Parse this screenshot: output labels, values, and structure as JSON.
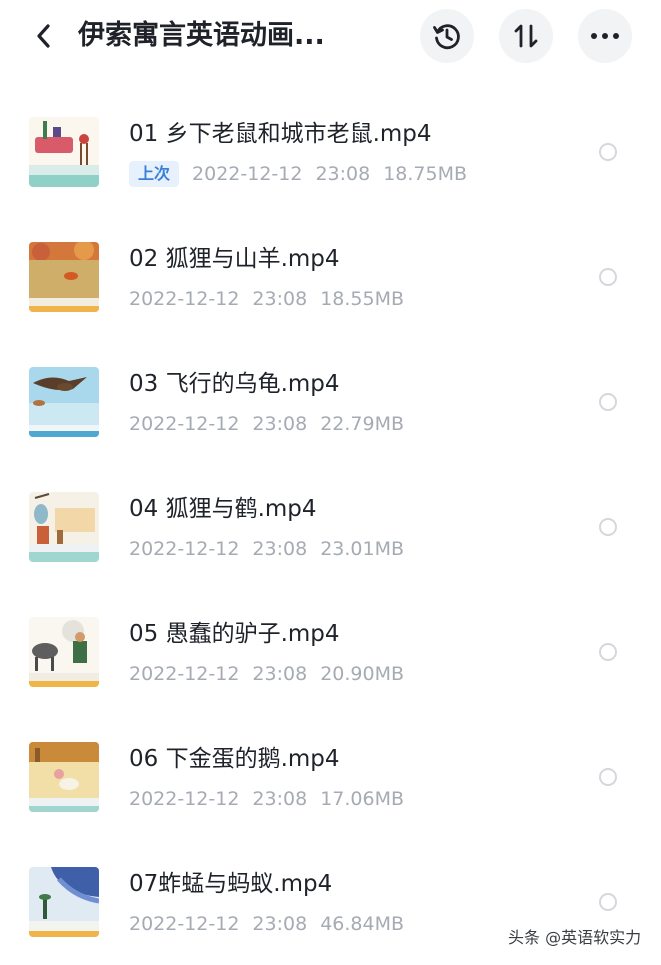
{
  "header": {
    "title": "伊索寓言英语动画...",
    "icons": [
      "chevron-left-icon",
      "history-icon",
      "sort-icon",
      "more-icon"
    ]
  },
  "files": [
    {
      "name": "01 乡下老鼠和城市老鼠.mp4",
      "badge": "上次",
      "date": "2022-12-12",
      "time": "23:08",
      "size": "18.75MB"
    },
    {
      "name": "02 狐狸与山羊.mp4",
      "badge": "",
      "date": "2022-12-12",
      "time": "23:08",
      "size": "18.55MB"
    },
    {
      "name": "03 飞行的乌龟.mp4",
      "badge": "",
      "date": "2022-12-12",
      "time": "23:08",
      "size": "22.79MB"
    },
    {
      "name": "04 狐狸与鹤.mp4",
      "badge": "",
      "date": "2022-12-12",
      "time": "23:08",
      "size": "23.01MB"
    },
    {
      "name": "05 愚蠢的驴子.mp4",
      "badge": "",
      "date": "2022-12-12",
      "time": "23:08",
      "size": "20.90MB"
    },
    {
      "name": "06 下金蛋的鹅.mp4",
      "badge": "",
      "date": "2022-12-12",
      "time": "23:08",
      "size": "17.06MB"
    },
    {
      "name": "07蚱蜢与蚂蚁.mp4",
      "badge": "",
      "date": "2022-12-12",
      "time": "23:08",
      "size": "46.84MB"
    }
  ],
  "watermark": "头条 @英语软实力",
  "colors": {
    "accent": "#3b7fd9",
    "badge_bg": "#e6f1fd",
    "meta_text": "#a6abb3",
    "title_text": "#1f2329"
  }
}
